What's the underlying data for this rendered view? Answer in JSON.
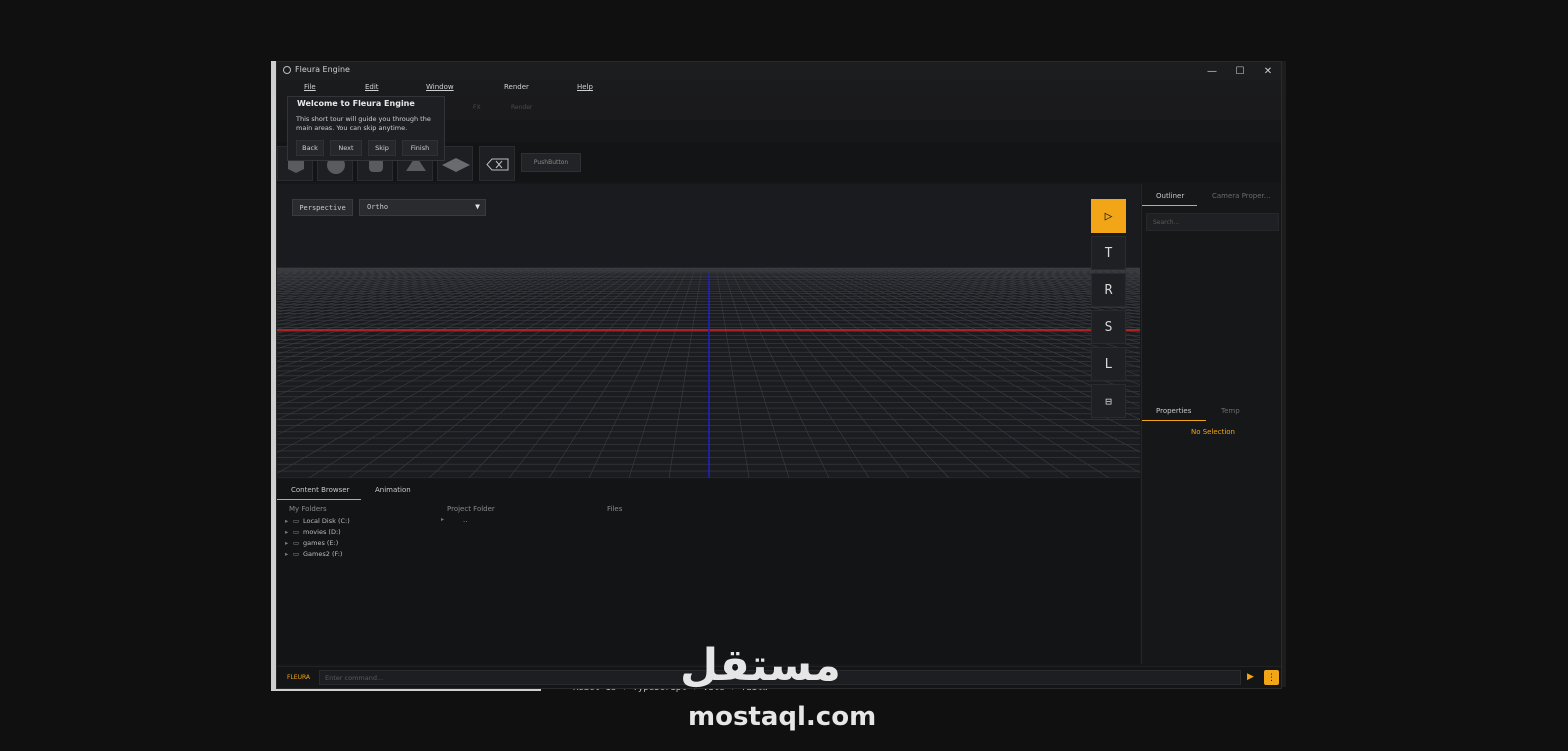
{
  "window": {
    "title": "Fleura Engine",
    "minimize": "—",
    "maximize": "☐",
    "close": "✕"
  },
  "menu": {
    "file": "File",
    "edit": "Edit",
    "window": "Window",
    "render": "Render",
    "help": "Help"
  },
  "tabs_ghost": {
    "fx": "FX",
    "render": "Render"
  },
  "toolbar": {
    "push_button": "PushButton"
  },
  "viewport": {
    "perspective_label": "Perspective",
    "view_mode": "Ortho",
    "dropdown_arrow": "▼",
    "gizmos": [
      {
        "name": "select",
        "glyph": "▷"
      },
      {
        "name": "translate",
        "glyph": "T"
      },
      {
        "name": "rotate",
        "glyph": "R"
      },
      {
        "name": "scale",
        "glyph": "S"
      },
      {
        "name": "light",
        "glyph": "L"
      },
      {
        "name": "snap",
        "glyph": "⊟"
      }
    ]
  },
  "outliner": {
    "tab_outliner": "Outliner",
    "tab_camera": "Camera Proper...",
    "search_placeholder": "Search..."
  },
  "properties": {
    "tab_properties": "Properties",
    "tab_temp": "Temp",
    "no_selection": "No Selection"
  },
  "content_browser": {
    "tab_content": "Content Browser",
    "tab_animation": "Animation",
    "col_folders": "My Folders",
    "col_project": "Project Folder",
    "col_files": "Files",
    "project_item": "..",
    "drives": [
      "Local Disk (C:)",
      "movies (D:)",
      "games (E:)",
      "Games2 (F:)"
    ]
  },
  "command": {
    "label": "FLEURA",
    "placeholder": "Enter command...",
    "run_icon": "▶",
    "settings_icon": "⋮"
  },
  "tour": {
    "title": "Welcome to Fleura Engine",
    "body": "This short tour will guide you through the main areas. You can skip anytime.",
    "back": "Back",
    "next": "Next",
    "skip": "Skip",
    "finish": "Finish"
  },
  "watermark": {
    "arabic": "مستقل",
    "latin": "mostaql.com"
  },
  "background": {
    "peek_text": "- React 18 + TypeScript + Vite + Tailw"
  },
  "colors": {
    "accent": "#f2a516",
    "x_axis": "#d42424",
    "z_axis": "#2020c8"
  }
}
